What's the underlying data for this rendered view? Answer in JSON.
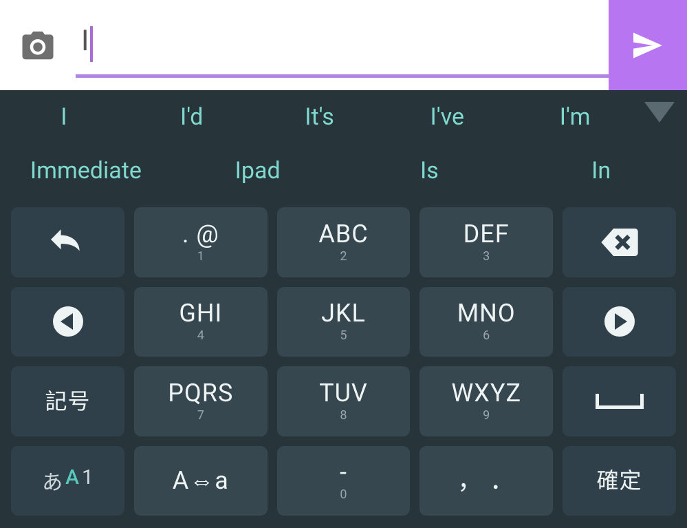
{
  "input": {
    "value": "I"
  },
  "suggestions_row1": [
    "I",
    "I'd",
    "It's",
    "I've",
    "I'm"
  ],
  "suggestions_row2": [
    "Immediate",
    "Ipad",
    "Is",
    "In"
  ],
  "keys": {
    "r0": {
      "c1": {
        "main": ". @",
        "sub": "1"
      },
      "c2": {
        "main": "ABC",
        "sub": "2"
      },
      "c3": {
        "main": "DEF",
        "sub": "3"
      }
    },
    "r1": {
      "c1": {
        "main": "GHI",
        "sub": "4"
      },
      "c2": {
        "main": "JKL",
        "sub": "5"
      },
      "c3": {
        "main": "MNO",
        "sub": "6"
      }
    },
    "r2": {
      "c0": {
        "main": "記号"
      },
      "c1": {
        "main": "PQRS",
        "sub": "7"
      },
      "c2": {
        "main": "TUV",
        "sub": "8"
      },
      "c3": {
        "main": "WXYZ",
        "sub": "9"
      }
    },
    "r3": {
      "mode": {
        "a": "あ",
        "b": "A",
        "c": "1"
      },
      "c1": {
        "main": "A⇔a"
      },
      "c2": {
        "main": "-",
        "sub": "0"
      },
      "c3": {
        "main": "，  ．"
      },
      "c4": {
        "main": "確定"
      }
    }
  },
  "colors": {
    "accent": "#b775f2",
    "underline": "#b084e0",
    "keyboard_bg": "#27343a",
    "key_bg": "#37474f",
    "key_func_bg": "#30404a",
    "suggestion_text": "#7fd9cf"
  }
}
